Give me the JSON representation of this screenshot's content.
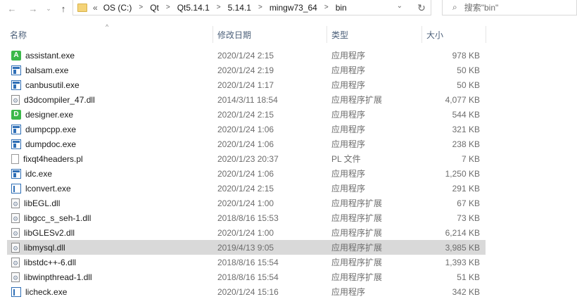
{
  "toolbar": {
    "back_icon": "arrow-left-icon",
    "forward_icon": "arrow-right-icon",
    "recent_icon": "chevron-down-icon",
    "up_icon": "arrow-up-icon",
    "overflow": "«",
    "breadcrumbs": [
      "OS (C:)",
      "Qt",
      "Qt5.14.1",
      "5.14.1",
      "mingw73_64",
      "bin"
    ],
    "search_placeholder": "搜索\"bin\""
  },
  "columns": {
    "name": "名称",
    "date": "修改日期",
    "type": "类型",
    "size": "大小"
  },
  "files": [
    {
      "name": "assistant.exe",
      "date": "2020/1/24 2:15",
      "type": "应用程序",
      "size": "978 KB",
      "icon": "green-a"
    },
    {
      "name": "balsam.exe",
      "date": "2020/1/24 2:19",
      "type": "应用程序",
      "size": "50 KB",
      "icon": "app"
    },
    {
      "name": "canbusutil.exe",
      "date": "2020/1/24 1:17",
      "type": "应用程序",
      "size": "50 KB",
      "icon": "app"
    },
    {
      "name": "d3dcompiler_47.dll",
      "date": "2014/3/11 18:54",
      "type": "应用程序扩展",
      "size": "4,077 KB",
      "icon": "dll"
    },
    {
      "name": "designer.exe",
      "date": "2020/1/24 2:15",
      "type": "应用程序",
      "size": "544 KB",
      "icon": "green-d"
    },
    {
      "name": "dumpcpp.exe",
      "date": "2020/1/24 1:06",
      "type": "应用程序",
      "size": "321 KB",
      "icon": "app"
    },
    {
      "name": "dumpdoc.exe",
      "date": "2020/1/24 1:06",
      "type": "应用程序",
      "size": "238 KB",
      "icon": "app"
    },
    {
      "name": "fixqt4headers.pl",
      "date": "2020/1/23 20:37",
      "type": "PL 文件",
      "size": "7 KB",
      "icon": "file"
    },
    {
      "name": "idc.exe",
      "date": "2020/1/24 1:06",
      "type": "应用程序",
      "size": "1,250 KB",
      "icon": "app"
    },
    {
      "name": "lconvert.exe",
      "date": "2020/1/24 2:15",
      "type": "应用程序",
      "size": "291 KB",
      "icon": "lc"
    },
    {
      "name": "libEGL.dll",
      "date": "2020/1/24 1:00",
      "type": "应用程序扩展",
      "size": "67 KB",
      "icon": "dll"
    },
    {
      "name": "libgcc_s_seh-1.dll",
      "date": "2018/8/16 15:53",
      "type": "应用程序扩展",
      "size": "73 KB",
      "icon": "dll"
    },
    {
      "name": "libGLESv2.dll",
      "date": "2020/1/24 1:00",
      "type": "应用程序扩展",
      "size": "6,214 KB",
      "icon": "dll"
    },
    {
      "name": "libmysql.dll",
      "date": "2019/4/13 9:05",
      "type": "应用程序扩展",
      "size": "3,985 KB",
      "icon": "dll",
      "selected": true
    },
    {
      "name": "libstdc++-6.dll",
      "date": "2018/8/16 15:54",
      "type": "应用程序扩展",
      "size": "1,393 KB",
      "icon": "dll"
    },
    {
      "name": "libwinpthread-1.dll",
      "date": "2018/8/16 15:54",
      "type": "应用程序扩展",
      "size": "51 KB",
      "icon": "dll"
    },
    {
      "name": "licheck.exe",
      "date": "2020/1/24 15:16",
      "type": "应用程序",
      "size": "342 KB",
      "icon": "lc"
    }
  ]
}
